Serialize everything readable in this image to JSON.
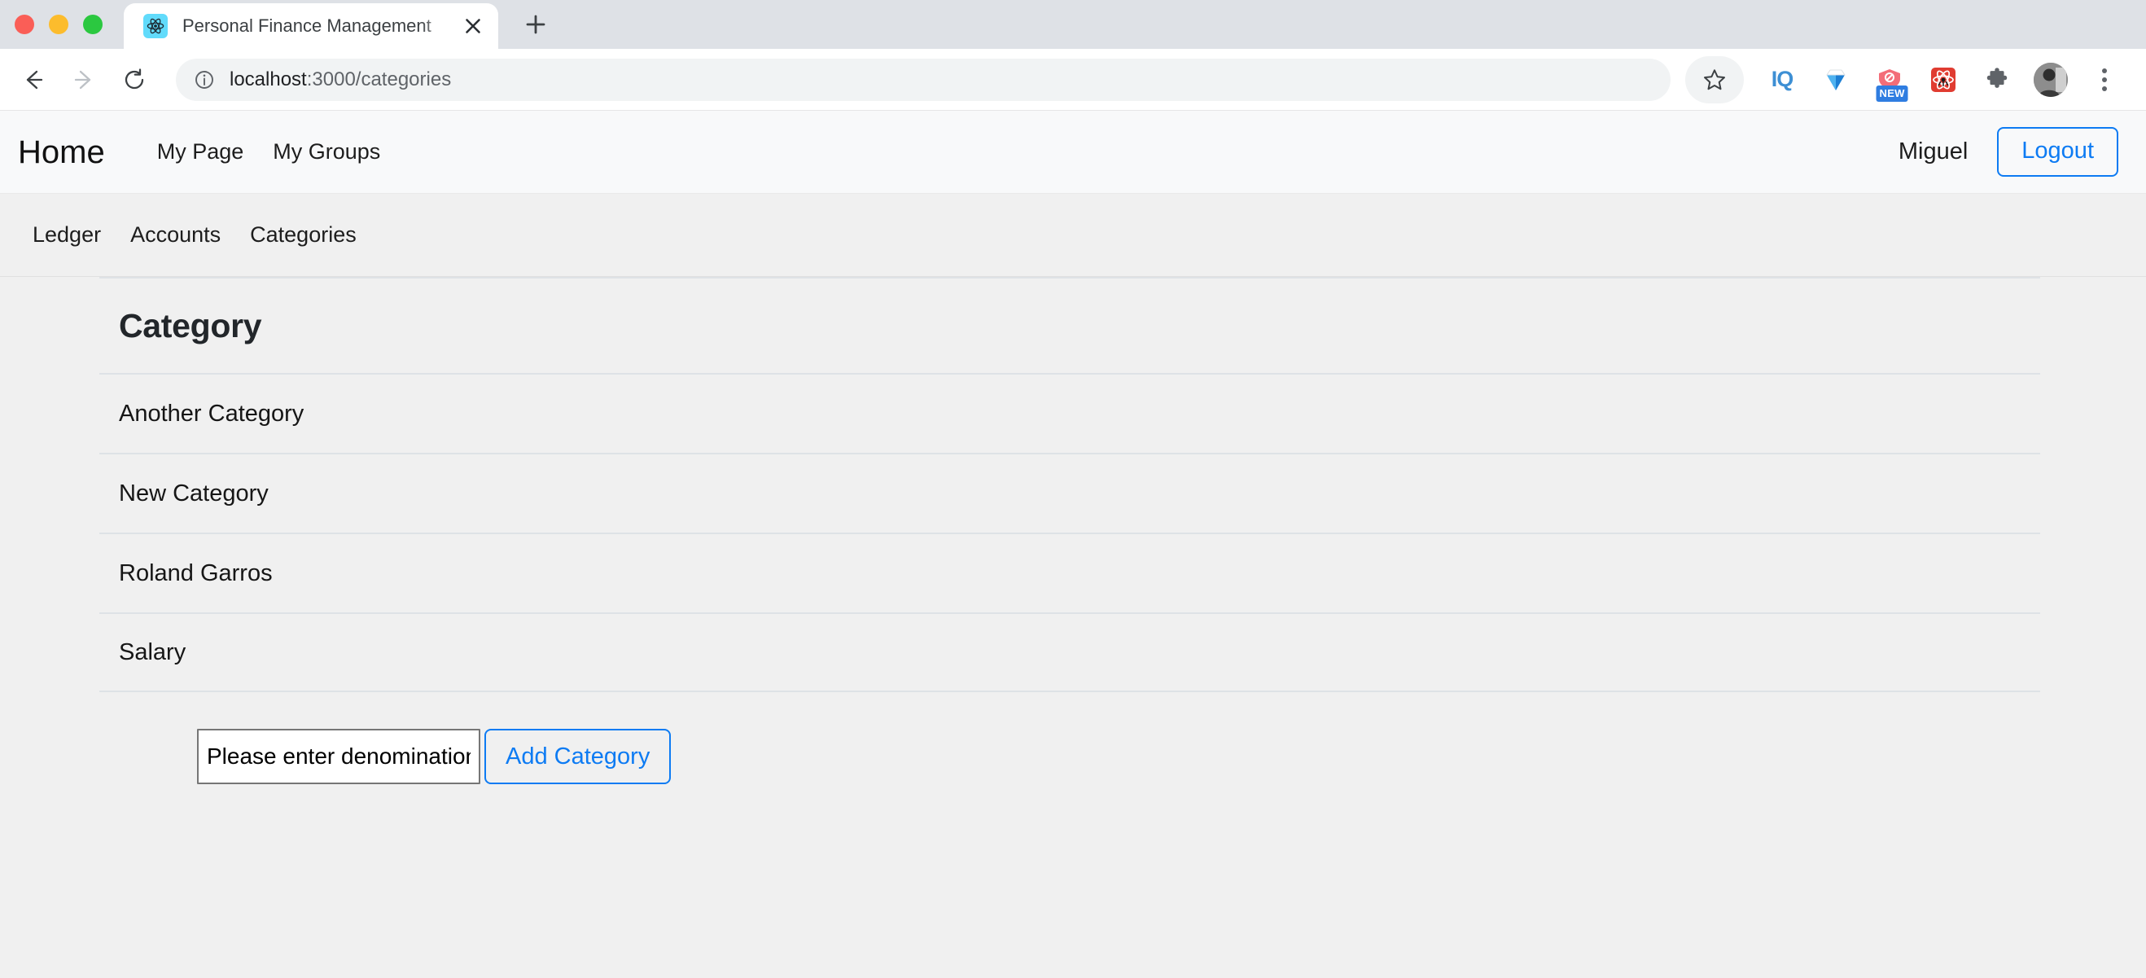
{
  "browser": {
    "window_controls": [
      "close",
      "minimize",
      "maximize"
    ],
    "tab": {
      "title": "Personal Finance Management",
      "favicon_name": "react-logo-icon",
      "close_label": "✕"
    },
    "new_tab_label": "+",
    "toolbar": {
      "back_label": "←",
      "forward_label": "→",
      "reload_label": "↻",
      "site_info_name": "info-circle-icon",
      "url_host": "localhost",
      "url_path": ":3000/categories",
      "bookmark_name": "star-icon"
    },
    "extensions": [
      {
        "name": "iq-extension-icon",
        "label": "IQ"
      },
      {
        "name": "diamond-extension-icon",
        "label": ""
      },
      {
        "name": "shield-extension-icon",
        "label": "",
        "badge": "NEW"
      },
      {
        "name": "react-devtools-icon",
        "label": ""
      },
      {
        "name": "puzzle-extensions-icon",
        "label": ""
      }
    ],
    "profile_name": "profile-avatar",
    "menu_name": "chrome-menu-icon"
  },
  "app": {
    "navbar": {
      "brand": "Home",
      "links": [
        {
          "label": "My Page"
        },
        {
          "label": "My Groups"
        }
      ],
      "username": "Miguel",
      "logout_label": "Logout"
    },
    "subnav": {
      "links": [
        {
          "label": "Ledger"
        },
        {
          "label": "Accounts"
        },
        {
          "label": "Categories"
        }
      ]
    },
    "main": {
      "heading": "Category",
      "items": [
        {
          "label": "Another Category"
        },
        {
          "label": "New Category"
        },
        {
          "label": "Roland Garros"
        },
        {
          "label": "Salary"
        }
      ],
      "form": {
        "input_value": "Please enter denomination",
        "input_placeholder": "Please enter denomination",
        "submit_label": "Add Category"
      }
    }
  },
  "colors": {
    "accent_blue": "#0d7bf3",
    "tabstrip": "#dee1e6",
    "app_navbar_bg": "#f8f9fa",
    "page_bg": "#f0f0f0",
    "divider": "#dee2e6"
  }
}
